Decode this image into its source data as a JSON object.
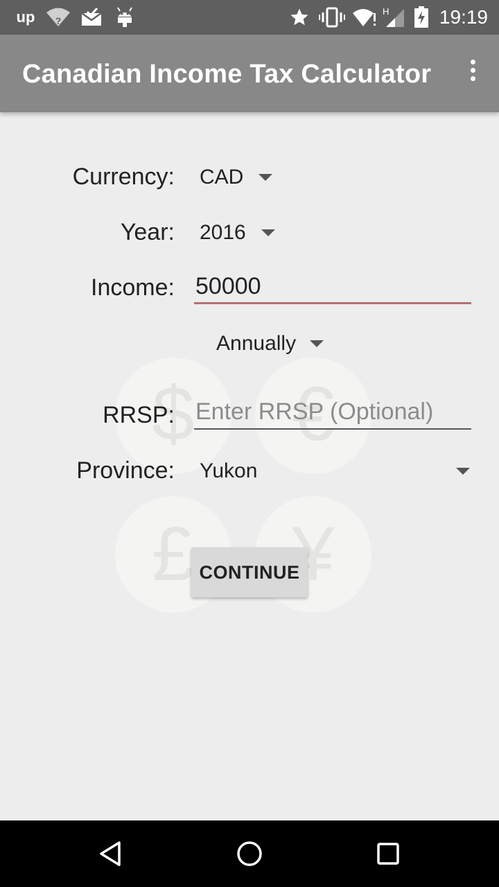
{
  "status_bar": {
    "time": "19:19",
    "left_icons": [
      "upwork-icon",
      "wifi-unknown-icon",
      "email-check-icon",
      "android-icon"
    ],
    "right_icons": [
      "star-icon",
      "vibrate-icon",
      "wifi-icon",
      "signal-icon",
      "battery-charging-icon"
    ],
    "upwork_glyph": "up",
    "network_type": "H"
  },
  "app_bar": {
    "title": "Canadian Income Tax Calculator",
    "menu_icon": "more-vert-icon"
  },
  "form": {
    "currency": {
      "label": "Currency:",
      "value": "CAD"
    },
    "year": {
      "label": "Year:",
      "value": "2016"
    },
    "income": {
      "label": "Income:",
      "value": "50000"
    },
    "period": {
      "value": "Annually"
    },
    "rrsp": {
      "label": "RRSP:",
      "value": "",
      "placeholder": "Enter RRSP (Optional)"
    },
    "province": {
      "label": "Province:",
      "value": "Yukon"
    }
  },
  "continue_label": "CONTINUE",
  "background_symbols": [
    "$",
    "€",
    "£",
    "¥"
  ],
  "colors": {
    "status_bar": "#5f5f5f",
    "app_bar": "#888888",
    "background": "#ededed",
    "income_underline": "#c0696b",
    "rrsp_underline": "#555555"
  }
}
